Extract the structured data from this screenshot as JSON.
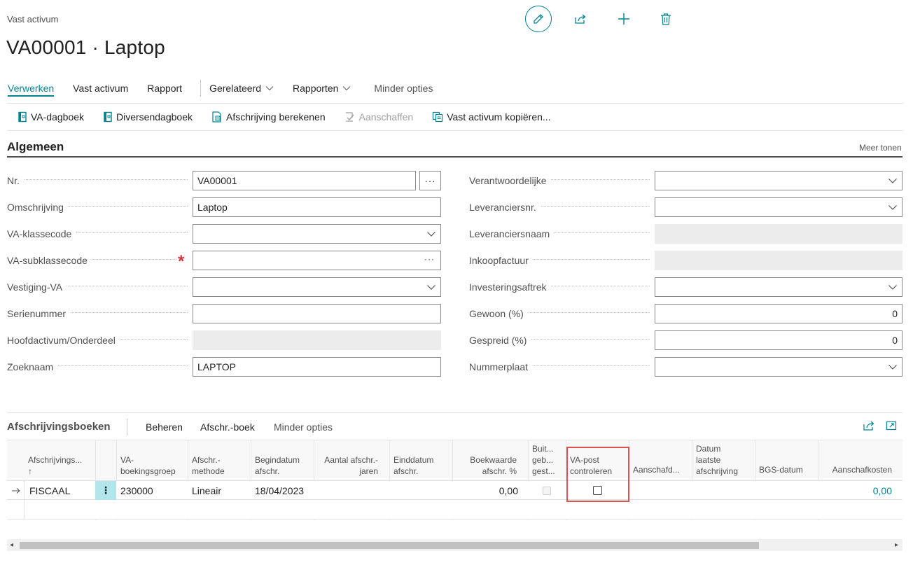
{
  "breadcrumb": "Vast activum",
  "page_title": "VA00001 · Laptop",
  "tabs": {
    "verwerken": "Verwerken",
    "vast_activum": "Vast activum",
    "rapport": "Rapport",
    "gerelateerd": "Gerelateerd",
    "rapporten": "Rapporten",
    "minder_opties": "Minder opties"
  },
  "actions": {
    "va_dagboek": "VA-dagboek",
    "diversendagboek": "Diversendagboek",
    "afschrijving_berekenen": "Afschrijving berekenen",
    "aanschaffen": "Aanschaffen",
    "kopieren": "Vast activum kopiëren..."
  },
  "section": {
    "title": "Algemeen",
    "more": "Meer tonen"
  },
  "fields_left": {
    "nr_label": "Nr.",
    "nr_value": "VA00001",
    "omschrijving_label": "Omschrijving",
    "omschrijving_value": "Laptop",
    "klassecode_label": "VA-klassecode",
    "klassecode_value": "",
    "subklassecode_label": "VA-subklassecode",
    "subklassecode_value": "",
    "vestiging_label": "Vestiging-VA",
    "vestiging_value": "",
    "serienummer_label": "Serienummer",
    "serienummer_value": "",
    "hoofdactivum_label": "Hoofdactivum/Onderdeel",
    "hoofdactivum_value": "",
    "zoeknaam_label": "Zoeknaam",
    "zoeknaam_value": "LAPTOP"
  },
  "fields_right": {
    "verantwoordelijke_label": "Verantwoordelijke",
    "verantwoordelijke_value": "",
    "leveranciersnr_label": "Leveranciersnr.",
    "leveranciersnr_value": "",
    "leveranciersnaam_label": "Leveranciersnaam",
    "leveranciersnaam_value": "",
    "inkoopfactuur_label": "Inkoopfactuur",
    "inkoopfactuur_value": "",
    "investeringsaftrek_label": "Investeringsaftrek",
    "investeringsaftrek_value": "",
    "gewoon_label": "Gewoon (%)",
    "gewoon_value": "0",
    "gespreid_label": "Gespreid (%)",
    "gespreid_value": "0",
    "nummerplaat_label": "Nummerplaat",
    "nummerplaat_value": ""
  },
  "subpage": {
    "title": "Afschrijvingsboeken",
    "beheren": "Beheren",
    "afschr_boek": "Afschr.-boek",
    "minder_opties": "Minder opties",
    "headers": {
      "afschrijvingsboek": "Afschrijvings...",
      "sort": "↑",
      "boekingsgroep_1": "VA-",
      "boekingsgroep_2": "boekingsgroep",
      "methode_1": "Afschr.-",
      "methode_2": "methode",
      "begindatum_1": "Begindatum",
      "begindatum_2": "afschr.",
      "aantal_1": "Aantal afschr.-",
      "aantal_2": "jaren",
      "einddatum_1": "Einddatum",
      "einddatum_2": "afschr.",
      "boekwaarde_1": "Boekwaarde",
      "boekwaarde_2": "afschr. %",
      "buiten_1": "Buit...",
      "buiten_2": "geb...",
      "buiten_3": "gest...",
      "vapost_1": "VA-post",
      "vapost_2": "controleren",
      "aanschafdatum": "Aanschafd...",
      "laatste_1": "Datum",
      "laatste_2": "laatste",
      "laatste_3": "afschrijving",
      "bgs": "BGS-datum",
      "aanschafkosten": "Aanschafkosten"
    },
    "row": {
      "boek": "FISCAAL",
      "boekingsgroep": "230000",
      "methode": "Lineair",
      "begindatum": "18/04/2023",
      "aantal": "",
      "einddatum": "",
      "boekwaarde": "0,00",
      "buiten": false,
      "vapost": false,
      "aanschafdatum": "",
      "laatste": "",
      "bgs": "",
      "aanschafkosten": "0,00"
    }
  },
  "colors": {
    "accent": "#00838f",
    "highlight": "#d9534f",
    "required": "#d13438"
  }
}
